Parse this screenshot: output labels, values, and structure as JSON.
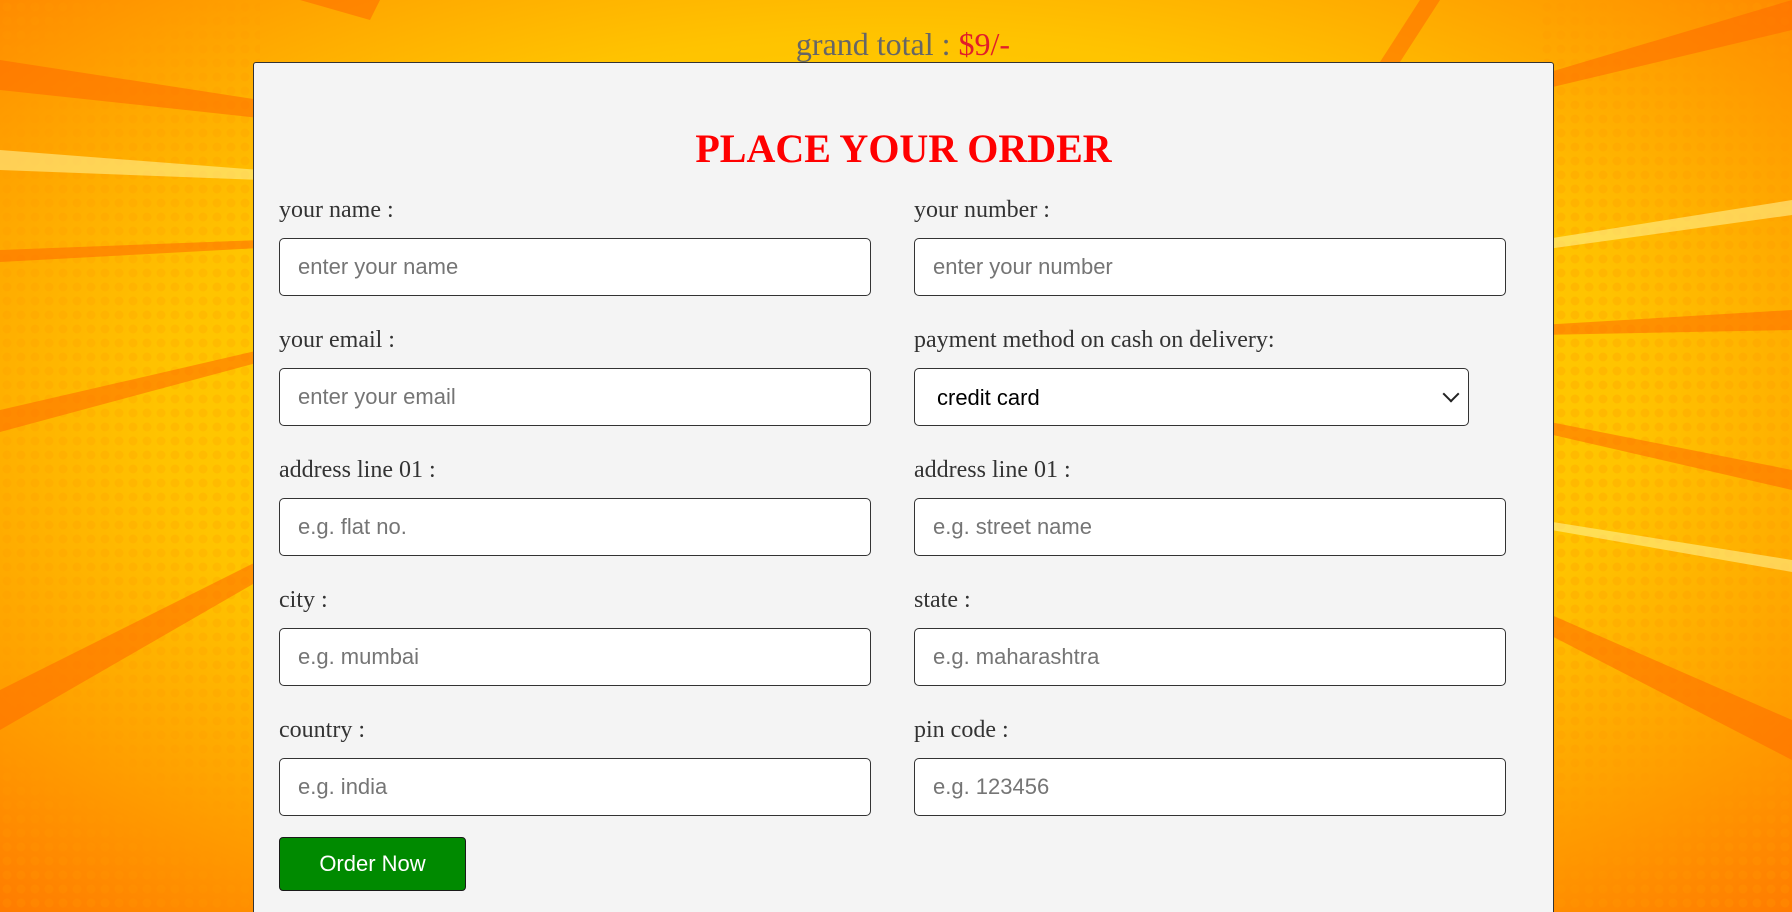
{
  "header": {
    "grand_total_label": "grand total : ",
    "grand_total_amount": "$9/-"
  },
  "form": {
    "title": "PLACE YOUR ORDER",
    "fields": {
      "name": {
        "label": "your name :",
        "placeholder": "enter your name"
      },
      "number": {
        "label": "your number :",
        "placeholder": "enter your number"
      },
      "email": {
        "label": "your email :",
        "placeholder": "enter your email"
      },
      "payment": {
        "label": "payment method on cash on delivery:",
        "selected": "credit card"
      },
      "flat": {
        "label": "address line 01 :",
        "placeholder": "e.g. flat no."
      },
      "street": {
        "label": "address line 01 :",
        "placeholder": "e.g. street name"
      },
      "city": {
        "label": "city :",
        "placeholder": "e.g. mumbai"
      },
      "state": {
        "label": "state :",
        "placeholder": "e.g. maharashtra"
      },
      "country": {
        "label": "country :",
        "placeholder": "e.g. india"
      },
      "pin": {
        "label": "pin code :",
        "placeholder": "e.g. 123456"
      }
    },
    "submit_label": "Order Now"
  },
  "colors": {
    "background": "#ffc400",
    "title": "#ff0000",
    "amount": "#e11d2a",
    "button": "#008a00",
    "card": "#f4f4f4"
  }
}
